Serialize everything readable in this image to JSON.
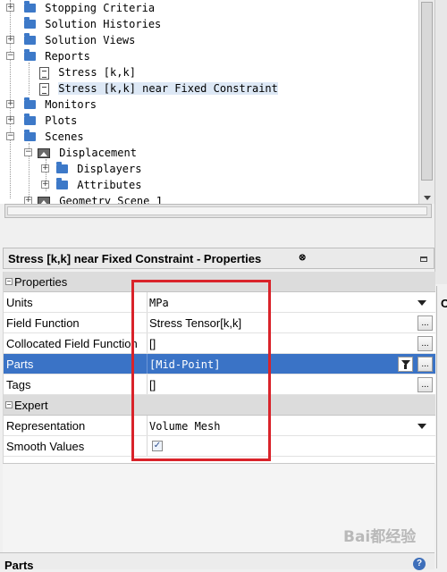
{
  "tree": {
    "items": [
      {
        "label": "Stopping Criteria"
      },
      {
        "label": "Solution Histories"
      },
      {
        "label": "Solution Views"
      },
      {
        "label": "Reports"
      },
      {
        "label": "Stress [k,k]"
      },
      {
        "label": "Stress [k,k] near Fixed Constraint"
      },
      {
        "label": "Monitors"
      },
      {
        "label": "Plots"
      },
      {
        "label": "Scenes"
      },
      {
        "label": "Displacement"
      },
      {
        "label": "Displayers"
      },
      {
        "label": "Attributes"
      },
      {
        "label": "Geometry Scene 1"
      }
    ]
  },
  "properties_panel": {
    "title": "Stress [k,k] near Fixed Constraint - Properties",
    "close_glyph": "⊗",
    "categories": {
      "properties": "Properties",
      "expert": "Expert"
    },
    "rows": {
      "units": {
        "key": "Units",
        "value": "MPa"
      },
      "field_function": {
        "key": "Field Function",
        "value": "Stress Tensor[k,k]"
      },
      "collocated": {
        "key": "Collocated Field Function",
        "value": "[]"
      },
      "parts": {
        "key": "Parts",
        "value": "[Mid-Point]"
      },
      "tags": {
        "key": "Tags",
        "value": "[]"
      },
      "representation": {
        "key": "Representation",
        "value": "Volume Mesh"
      },
      "smooth_values": {
        "key": "Smooth Values",
        "checked": true
      }
    },
    "ellipsis_glyph": "...",
    "check_glyph": "✓"
  },
  "side_panel": {
    "label": "C"
  },
  "bottom": {
    "title": "Parts",
    "help_glyph": "?"
  },
  "watermark": {
    "text": "Bai都经验"
  },
  "colors": {
    "selection": "#3a73c6",
    "highlight_box": "#d9232a",
    "folder": "#3d79c8"
  }
}
